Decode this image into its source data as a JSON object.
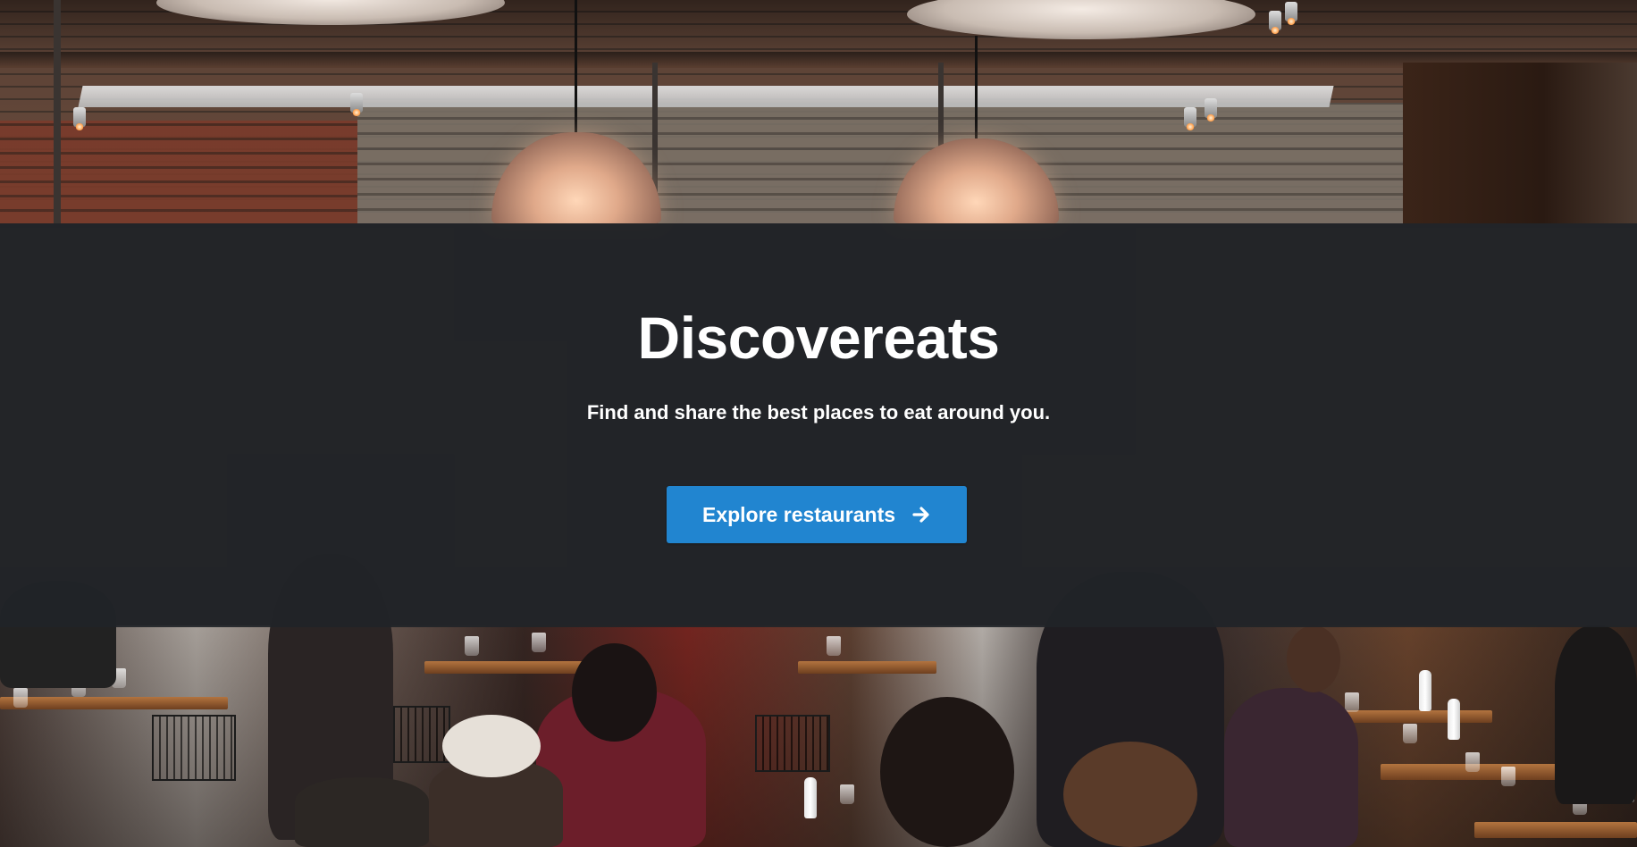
{
  "hero": {
    "title": "Discovereats",
    "subtitle": "Find and share the best places to eat around you.",
    "cta_label": "Explore restaurants",
    "cta_icon": "arrow-right-icon"
  },
  "colors": {
    "overlay": "#212428",
    "cta_background": "#2185d0",
    "text": "#ffffff"
  }
}
